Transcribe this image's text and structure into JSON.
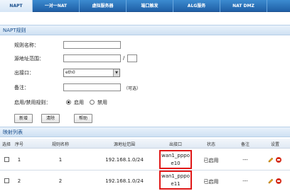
{
  "tabs": [
    {
      "label": "NAPT",
      "active": true
    },
    {
      "label": "一对一NAT",
      "active": false
    },
    {
      "label": "虚拟服务器",
      "active": false
    },
    {
      "label": "端口触发",
      "active": false
    },
    {
      "label": "ALG服务",
      "active": false
    },
    {
      "label": "NAT DMZ",
      "active": false
    }
  ],
  "rule_section": {
    "title": "NAPT规则",
    "rule_name_label": "规则名称：",
    "rule_name_value": "",
    "src_range_label": "源地址范围：",
    "src_range_start": "",
    "src_range_separator": "/",
    "src_range_end": "",
    "out_iface_label": "出接口：",
    "out_iface_value": "eth0",
    "note_label": "备注：",
    "note_value": "",
    "note_hint": "（可选）",
    "enable_label": "启用/禁用规则：",
    "enable_option": "启用",
    "disable_option": "禁用",
    "enabled": true
  },
  "buttons": {
    "add": "新增",
    "clear": "清除",
    "help": "帮助"
  },
  "list_section": {
    "title": "映射列表",
    "columns": [
      "选择",
      "序号",
      "规则名称",
      "源地址范围",
      "出接口",
      "状态",
      "备注",
      "设置"
    ],
    "rows": [
      {
        "index": "1",
        "name": "1",
        "src_range": "192.168.1.0/24",
        "iface_line1": "wan1_pppo",
        "iface_line2": "e10",
        "status": "已启用",
        "note": "---"
      },
      {
        "index": "2",
        "name": "2",
        "src_range": "192.168.1.0/24",
        "iface_line1": "wan1_pppo",
        "iface_line2": "e11",
        "status": "已启用",
        "note": "---"
      }
    ]
  },
  "colors": {
    "tab_bar": "#2a6fb8",
    "section_text": "#1a4f8d",
    "highlight_box": "#e01818"
  }
}
